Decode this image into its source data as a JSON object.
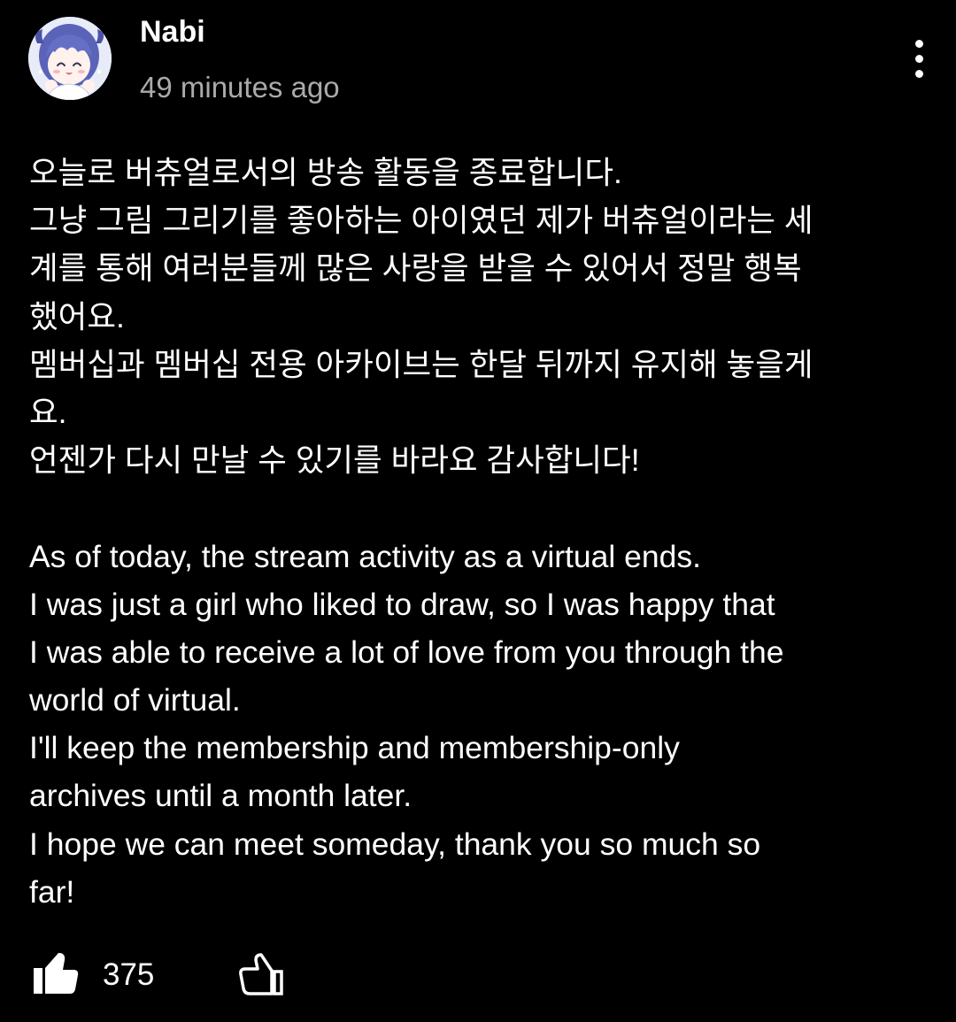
{
  "comment": {
    "author": "Nabi",
    "timestamp": "49 minutes ago",
    "avatar": "anime-girl-avatar",
    "menu_icon": "more-vertical-icon",
    "korean_lines": [
      "오늘로 버츄얼로서의 방송 활동을 종료합니다.",
      "그냥 그림 그리기를 좋아하는 아이였던 제가 버츄얼이라는 세",
      "계를 통해 여러분들께 많은 사랑을 받을 수 있어서 정말 행복",
      "했어요.",
      "멤버십과 멤버십 전용 아카이브는 한달 뒤까지 유지해 놓을게",
      "요.",
      "언젠가 다시 만날 수 있기를 바라요 감사합니다!"
    ],
    "english_lines": [
      "As of today, the stream activity as a virtual ends.",
      "I was just a girl who liked to draw, so I was happy that",
      "I was able to receive a lot of love from you through the",
      "world of virtual.",
      "I'll keep the membership and membership-only",
      "archives until a month later.",
      "I hope we can meet someday, thank you so much so",
      "far!"
    ],
    "like_count": "375",
    "like_icon": "thumbs-up-icon",
    "dislike_icon": "thumbs-down-icon"
  },
  "colors": {
    "background": "#000000",
    "text": "#ffffff",
    "secondary_text": "#aaaaaa"
  }
}
